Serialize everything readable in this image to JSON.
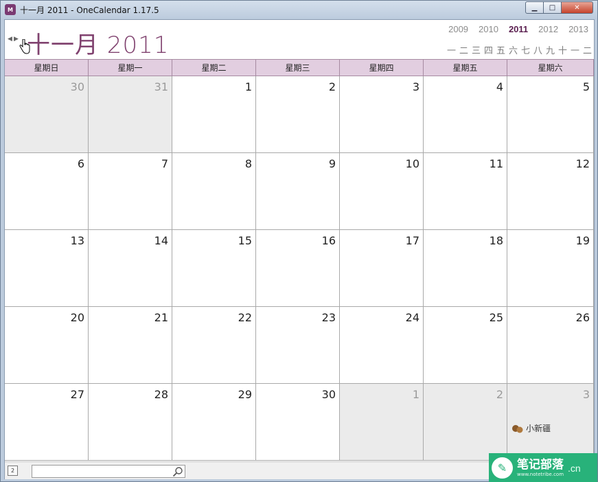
{
  "window": {
    "title": "十一月 2011 - OneCalendar 1.17.5",
    "app_icon_text": "M"
  },
  "controls": {
    "minimize": "▁",
    "maximize": "□",
    "close": "✕"
  },
  "header": {
    "month_title": "十一月 2011",
    "prev_arrow": "◀",
    "next_arrow": "▶",
    "years": [
      {
        "label": "2009"
      },
      {
        "label": "2010"
      },
      {
        "label": "2011"
      },
      {
        "label": "2012"
      },
      {
        "label": "2013"
      }
    ],
    "current_year_index": 2,
    "months": [
      "一",
      "二",
      "三",
      "四",
      "五",
      "六",
      "七",
      "八",
      "九",
      "十",
      "一",
      "二"
    ]
  },
  "calendar": {
    "weekdays": [
      "星期日",
      "星期一",
      "星期二",
      "星期三",
      "星期四",
      "星期五",
      "星期六"
    ],
    "weeks": [
      [
        {
          "d": "30",
          "o": true
        },
        {
          "d": "31",
          "o": true
        },
        {
          "d": "1"
        },
        {
          "d": "2"
        },
        {
          "d": "3"
        },
        {
          "d": "4"
        },
        {
          "d": "5"
        }
      ],
      [
        {
          "d": "6"
        },
        {
          "d": "7"
        },
        {
          "d": "8"
        },
        {
          "d": "9"
        },
        {
          "d": "10"
        },
        {
          "d": "11"
        },
        {
          "d": "12"
        }
      ],
      [
        {
          "d": "13"
        },
        {
          "d": "14"
        },
        {
          "d": "15"
        },
        {
          "d": "16"
        },
        {
          "d": "17"
        },
        {
          "d": "18"
        },
        {
          "d": "19"
        }
      ],
      [
        {
          "d": "20"
        },
        {
          "d": "21"
        },
        {
          "d": "22"
        },
        {
          "d": "23"
        },
        {
          "d": "24"
        },
        {
          "d": "25"
        },
        {
          "d": "26"
        }
      ],
      [
        {
          "d": "27"
        },
        {
          "d": "28"
        },
        {
          "d": "29"
        },
        {
          "d": "30"
        },
        {
          "d": "1",
          "o": true
        },
        {
          "d": "2",
          "o": true
        },
        {
          "d": "3",
          "o": true
        }
      ]
    ]
  },
  "statusbar": {
    "calendar_icon_text": "2",
    "search_value": "",
    "search_placeholder": ""
  },
  "mascot": {
    "text": "小新疆"
  },
  "watermark": {
    "main": "笔记部落",
    "sub": "www.notetribe.com",
    "suffix": ".cn"
  },
  "colors": {
    "accent": "#80426f",
    "header_bg": "#e2cee0",
    "other_month_bg": "#ebebeb",
    "watermark_bg": "#28b27a"
  }
}
